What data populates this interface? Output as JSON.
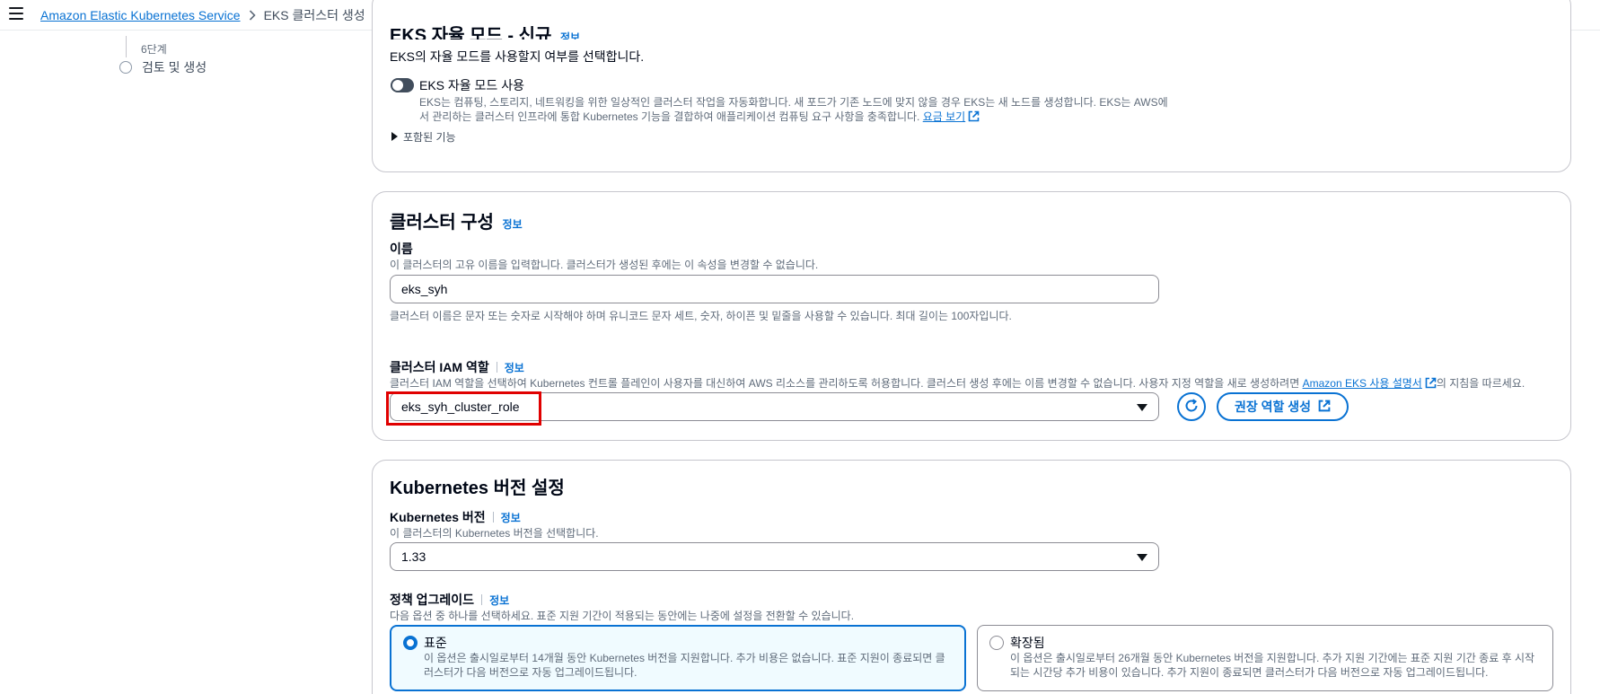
{
  "breadcrumb": {
    "service": "Amazon Elastic Kubernetes Service",
    "current": "EKS 클러스터 생성"
  },
  "stepper": {
    "prev_step_small": "6단계",
    "step_label": "검토 및 생성"
  },
  "auto_mode": {
    "title": "EKS 자율 모드 - 신규",
    "info": "정보",
    "description": "EKS의 자율 모드를 사용할지 여부를 선택합니다.",
    "toggle_label": "EKS 자율 모드 사용",
    "toggle_on": false,
    "toggle_desc_line1": "EKS는 컴퓨팅, 스토리지, 네트워킹을 위한 일상적인 클러스터 작업을 자동화합니다. 새 포드가 기존 노드에 맞지 않을 경우 EKS는 새 노드를 생성합니다. EKS는 AWS에",
    "toggle_desc_line2": "서 관리하는 클러스터 인프라에 통합 Kubernetes 기능을 결합하여 애플리케이션 컴퓨팅 요구 사항을 충족합니다.",
    "pricing_link": "요금 보기",
    "expander": "포함된 기능"
  },
  "cluster_config": {
    "title": "클러스터 구성",
    "info": "정보",
    "name_label": "이름",
    "name_desc": "이 클러스터의 고유 이름을 입력합니다. 클러스터가 생성된 후에는 이 속성을 변경할 수 없습니다.",
    "name_value": "eks_syh",
    "name_constraint": "클러스터 이름은 문자 또는 숫자로 시작해야 하며 유니코드 문자 세트, 숫자, 하이픈 및 밑줄을 사용할 수 있습니다. 최대 길이는 100자입니다.",
    "role_label": "클러스터 IAM 역할",
    "role_info": "정보",
    "role_desc": "클러스터 IAM 역할을 선택하여 Kubernetes 컨트롤 플레인이 사용자를 대신하여 AWS 리소스를 관리하도록 허용합니다. 클러스터 생성 후에는 이름 변경할 수 없습니다. 사용자 지정 역할을 새로 생성하려면",
    "role_desc_link": "Amazon EKS 사용 설명서",
    "role_desc_suffix": "의 지침을 따르세요.",
    "role_value": "eks_syh_cluster_role",
    "create_role_button": "권장 역할 생성"
  },
  "k8s_version": {
    "title": "Kubernetes 버전 설정",
    "version_label": "Kubernetes 버전",
    "version_info": "정보",
    "version_desc": "이 클러스터의 Kubernetes 버전을 선택합니다.",
    "version_value": "1.33",
    "policy_label": "정책 업그레이드",
    "policy_info": "정보",
    "policy_desc": "다음 옵션 중 하나를 선택하세요. 표준 지원 기간이 적용되는 동안에는 나중에 설정을 전환할 수 있습니다.",
    "options": [
      {
        "title": "표준",
        "selected": true,
        "desc_line1": "이 옵션은 출시일로부터 14개월 동안 Kubernetes 버전을 지원합니다. 추가 비용은 없습니다. 표준 지원이 종료되면 클",
        "desc_line2": "러스터가 다음 버전으로 자동 업그레이드됩니다."
      },
      {
        "title": "확장됨",
        "selected": false,
        "desc_line1": "이 옵션은 출시일로부터 26개월 동안 Kubernetes 버전을 지원합니다. 추가 지원 기간에는 표준 지원 기간 종료 후 시작",
        "desc_line2": "되는 시간당 추가 비용이 있습니다. 추가 지원이 종료되면 클러스터가 다음 버전으로 자동 업그레이드됩니다."
      }
    ]
  },
  "colors": {
    "link": "#0972d3",
    "highlight": "#e00000",
    "selected_bg": "#f0fbff"
  }
}
